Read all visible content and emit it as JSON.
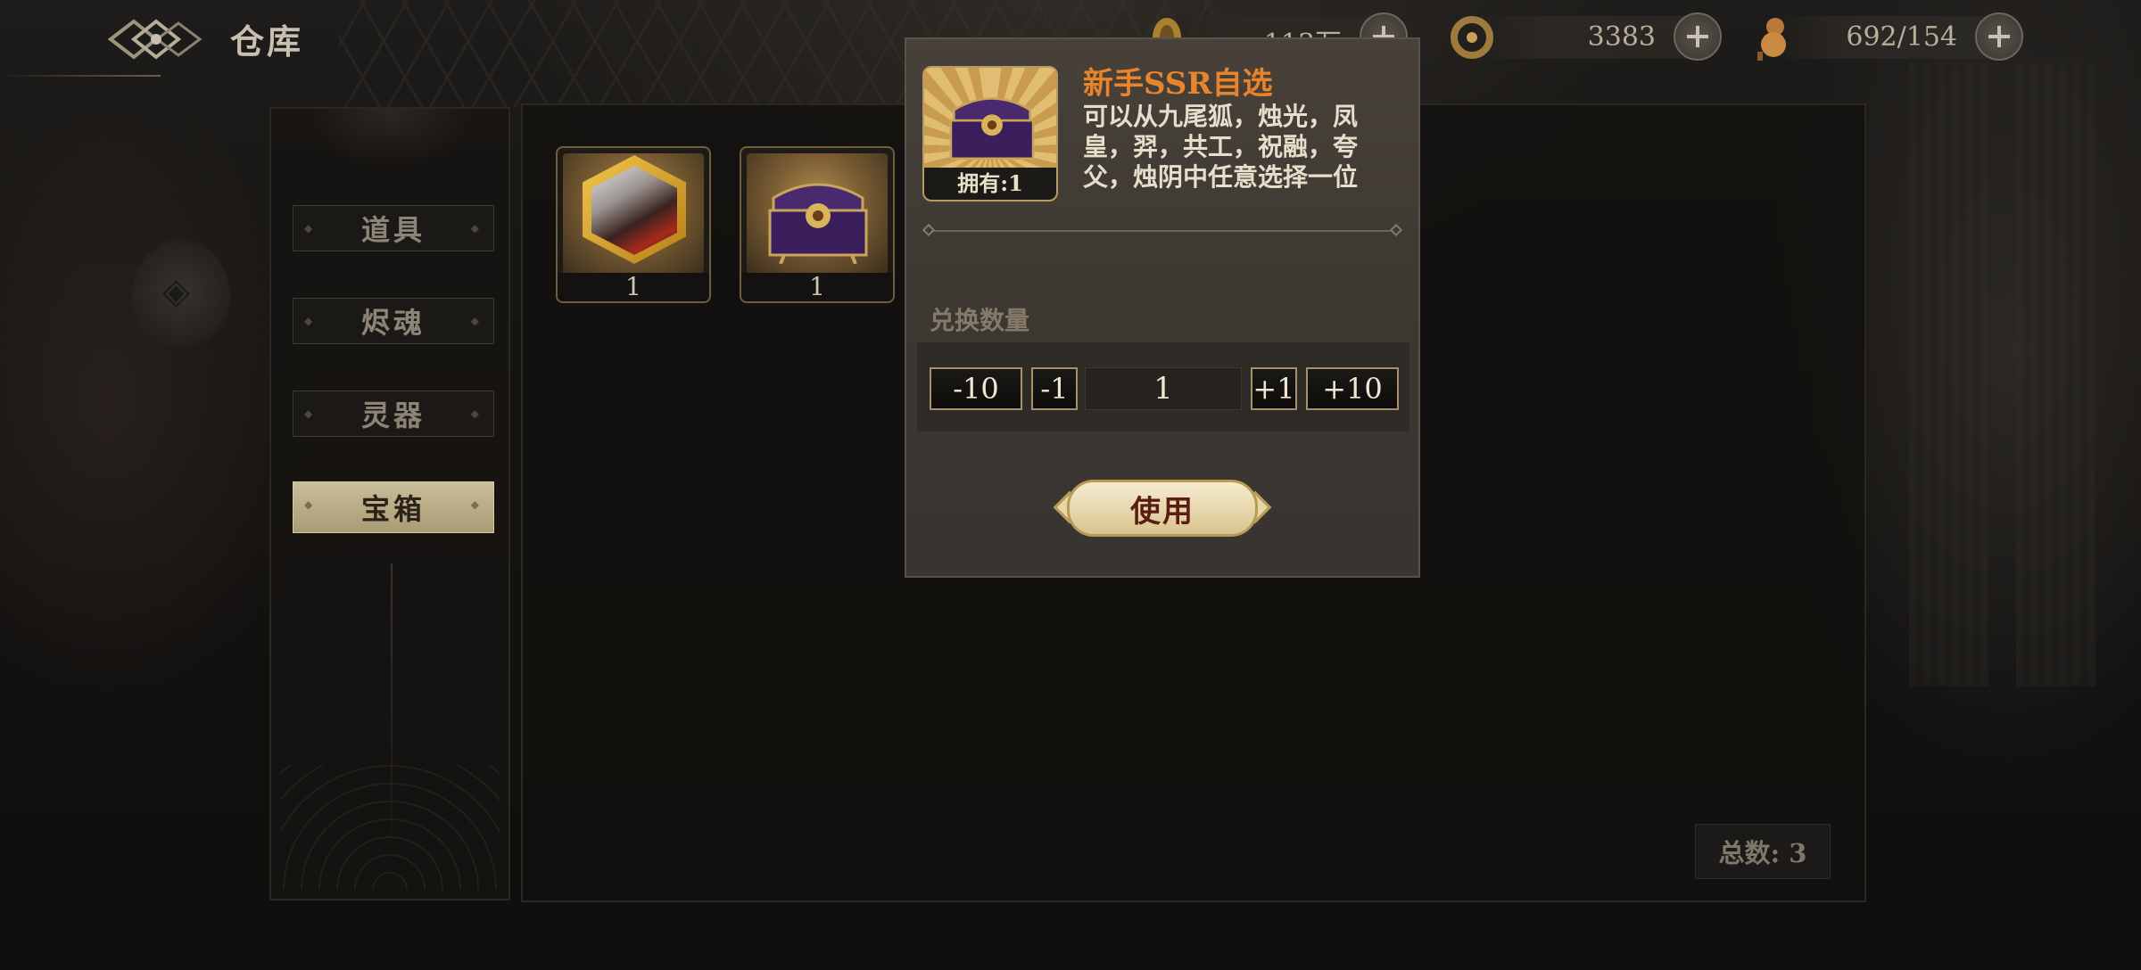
{
  "header": {
    "title": "仓库"
  },
  "resources": [
    {
      "icon": "gold-coin-icon",
      "value": "113万"
    },
    {
      "icon": "dragon-jade-icon",
      "value": "3383"
    },
    {
      "icon": "gourd-icon",
      "value": "692/154"
    }
  ],
  "sidebar": {
    "tabs": [
      "道具",
      "烬魂",
      "灵器",
      "宝箱"
    ],
    "active": "宝箱"
  },
  "inventory": {
    "items": [
      {
        "icon": "hero-portrait-icon",
        "count": "1"
      },
      {
        "icon": "treasure-chest-icon",
        "count": "1"
      }
    ],
    "total_label": "总数: 3"
  },
  "dialog": {
    "title": "新手SSR自选",
    "owned": "拥有:1",
    "description": "可以从九尾狐，烛光，凤皇，羿，共工，祝融，夸父，烛阴中任意选择一位",
    "quantity_label": "兑换数量",
    "buttons": {
      "minus10": "-10",
      "minus1": "-1",
      "plus1": "+1",
      "plus10": "+10"
    },
    "quantity": "1",
    "use_label": "使用"
  },
  "colors": {
    "title_orange": "#e8842b",
    "active_tab": "#c9bd9a",
    "use_button": "#f5eccf"
  }
}
